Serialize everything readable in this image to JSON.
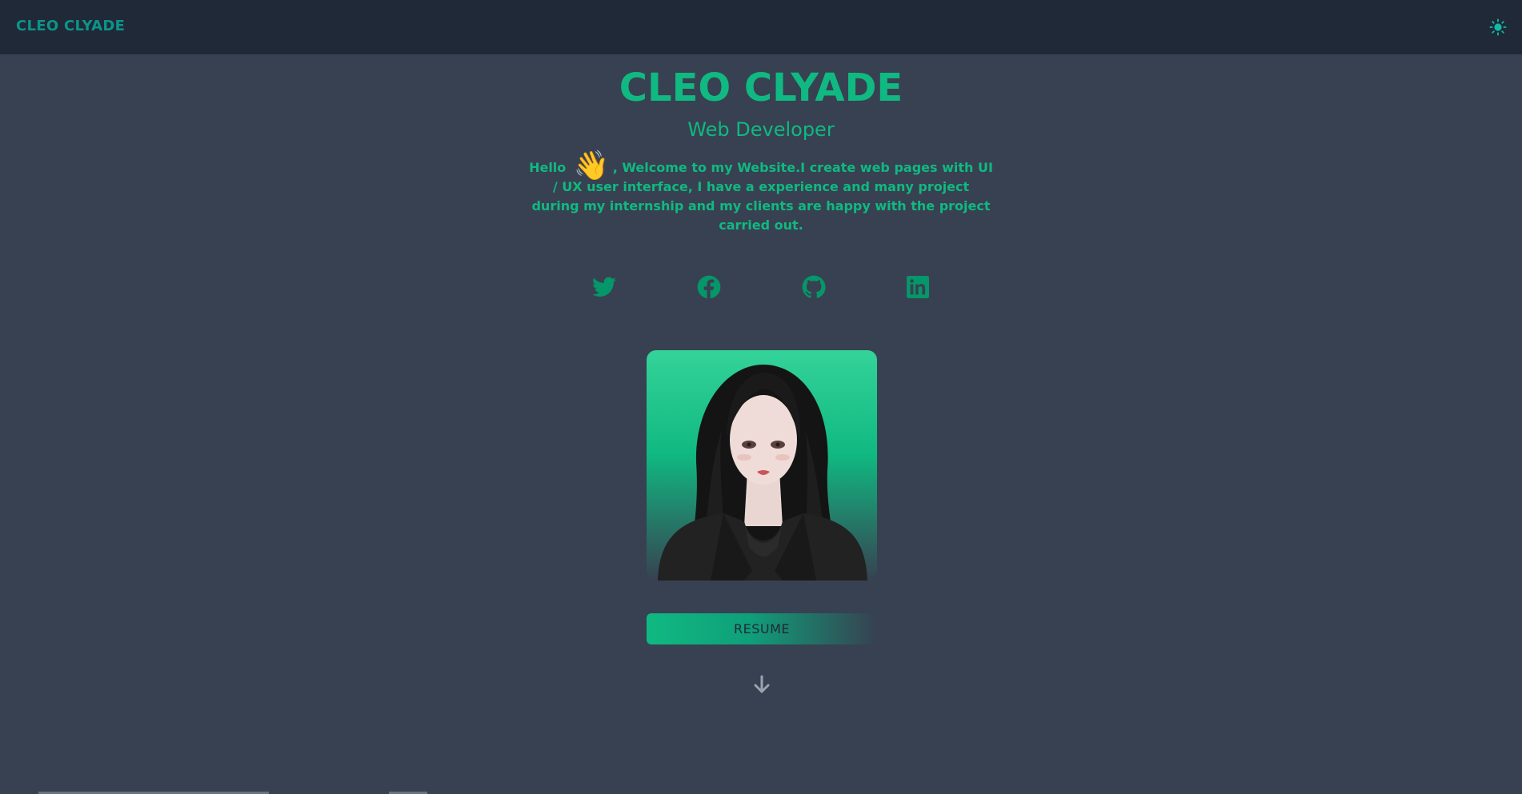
{
  "navbar": {
    "brand": "CLEO CLYADE",
    "theme_icon": "sun-icon"
  },
  "hero": {
    "name": "CLEO CLYADE",
    "role": "Web Developer",
    "greeting": "Hello",
    "wave_emoji": "👋",
    "intro_text": ", Welcome to my Website.I create web pages with UI / UX user interface, I have a experience and many project during my internship and my clients are happy with the project carried out."
  },
  "socials": [
    {
      "icon": "twitter-icon"
    },
    {
      "icon": "facebook-icon"
    },
    {
      "icon": "github-icon"
    },
    {
      "icon": "linkedin-icon"
    }
  ],
  "avatar": {
    "icon": "avatar-portrait"
  },
  "resume_button": {
    "label": "RESUME"
  },
  "scroll_icon": "arrow-down-icon",
  "colors": {
    "background": "#374151",
    "navbar": "#1f2937",
    "accent": "#10b981",
    "brand": "#0d9488",
    "muted": "#9ca3af"
  }
}
